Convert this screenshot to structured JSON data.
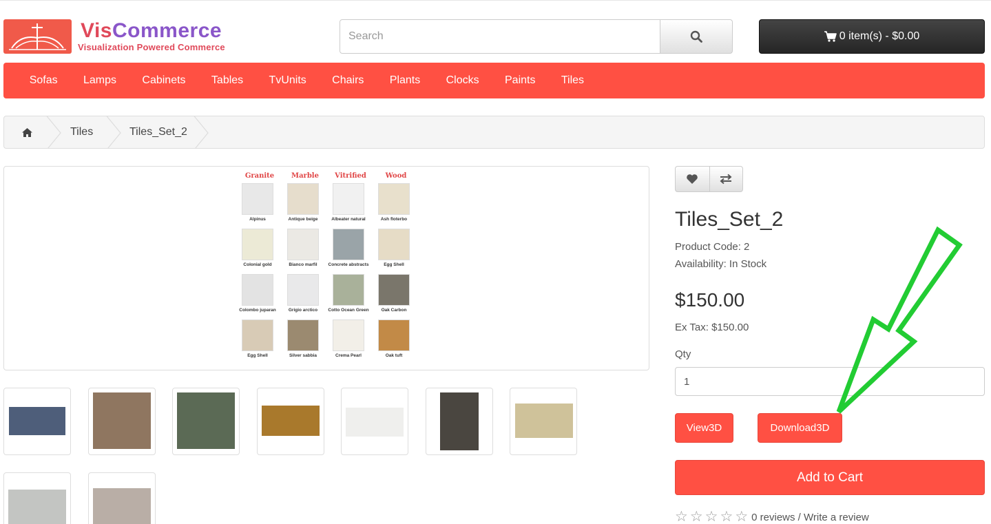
{
  "brand": {
    "name_part1": "Vis",
    "name_part2": "Commerce",
    "tagline": "Visualization Powered Commerce"
  },
  "search": {
    "placeholder": "Search",
    "icon": "search-icon"
  },
  "cart": {
    "label": "0 item(s) - $0.00",
    "icon": "shopping-cart-icon"
  },
  "menu": {
    "items": [
      "Sofas",
      "Lamps",
      "Cabinets",
      "Tables",
      "TvUnits",
      "Chairs",
      "Plants",
      "Clocks",
      "Paints",
      "Tiles"
    ]
  },
  "breadcrumb": {
    "home_icon": "home-icon",
    "items": [
      "Tiles",
      "Tiles_Set_2"
    ]
  },
  "tile_chart": {
    "columns": [
      "Granite",
      "Marble",
      "Vitrified",
      "Wood"
    ],
    "rows": [
      [
        {
          "label": "Alpinus",
          "color": "#e8e8e8"
        },
        {
          "label": "Antique beige",
          "color": "#e6ddcc"
        },
        {
          "label": "Albeater natural",
          "color": "#f1f1f1"
        },
        {
          "label": "Ash floterbo",
          "color": "#e8e0cc"
        }
      ],
      [
        {
          "label": "Colonial gold",
          "color": "#ecead6"
        },
        {
          "label": "Bianco marfil",
          "color": "#ebe9e4"
        },
        {
          "label": "Concrete abstracts",
          "color": "#9aa4a8"
        },
        {
          "label": "Egg Shell",
          "color": "#e6dcc6"
        }
      ],
      [
        {
          "label": "Colombo juparan",
          "color": "#e3e3e3"
        },
        {
          "label": "Grigio arctico",
          "color": "#e9e9ea"
        },
        {
          "label": "Cotto Ocean Green",
          "color": "#a9b19a"
        },
        {
          "label": "Oak Carbon",
          "color": "#7a766b"
        }
      ],
      [
        {
          "label": "Egg Shell",
          "color": "#d8cbb6"
        },
        {
          "label": "Silver sabbia",
          "color": "#9b8a70"
        },
        {
          "label": "Crema Pearl",
          "color": "#f2efe8"
        },
        {
          "label": "Oak tuft",
          "color": "#c28a47"
        }
      ]
    ]
  },
  "thumbnails": [
    {
      "name": "blue-stone",
      "color": "#4e5e7a"
    },
    {
      "name": "brown-granite",
      "color": "#8f7660"
    },
    {
      "name": "green-marble",
      "color": "#5b6a55"
    },
    {
      "name": "gold-tile",
      "color": "#a9792c"
    },
    {
      "name": "white-tile",
      "color": "#efefed"
    },
    {
      "name": "dark-wood",
      "color": "#4a4640"
    },
    {
      "name": "sand-stone",
      "color": "#cfc29a"
    },
    {
      "name": "grey-marble",
      "color": "#c3c5c2"
    },
    {
      "name": "pink-marble",
      "color": "#b9aea6"
    }
  ],
  "product": {
    "title": "Tiles_Set_2",
    "code_line": "Product Code: 2",
    "availability_line": "Availability: In Stock",
    "price": "$150.00",
    "ex_tax_line": "Ex Tax: $150.00",
    "qty_label": "Qty",
    "qty_value": "1",
    "view3d_label": "View3D",
    "download3d_label": "Download3D",
    "add_to_cart_label": "Add to Cart",
    "wishlist_icon": "heart-icon",
    "compare_icon": "exchange-icon",
    "rating_stars": 0,
    "rating_text": "0 reviews / Write a review"
  },
  "colors": {
    "accent": "#ff5043",
    "arrow": "#22cc33",
    "cart_bg": "#2b2b2b"
  }
}
